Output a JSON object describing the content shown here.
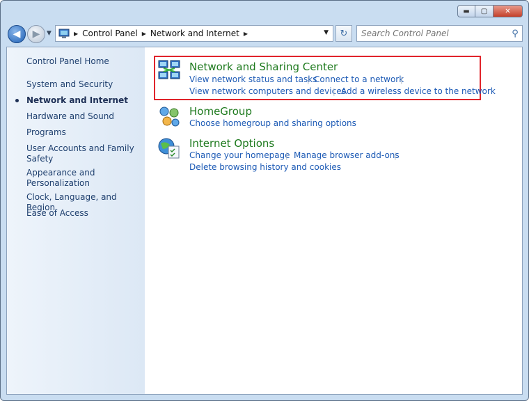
{
  "window": {
    "caption": {
      "minimize_glyph": "▬",
      "maximize_glyph": "▢",
      "close_glyph": "✕"
    }
  },
  "nav": {
    "back_glyph": "◀",
    "forward_glyph": "▶",
    "breadcrumb": [
      "Control Panel",
      "Network and Internet"
    ],
    "crumb_separator": "▶",
    "refresh_glyph": "↻",
    "search_placeholder": "Search Control Panel",
    "search_glyph": "⚲"
  },
  "sidebar": {
    "home": "Control Panel Home",
    "items": [
      "System and Security",
      "Network and Internet",
      "Hardware and Sound",
      "Programs",
      "User Accounts and Family Safety",
      "Appearance and Personalization",
      "Clock, Language, and Region",
      "Ease of Access"
    ],
    "current_index": 1
  },
  "categories": [
    {
      "title": "Network and Sharing Center",
      "icon": "network-sharing-icon",
      "links": [
        "View network status and tasks",
        "Connect to a network",
        "View network computers and devices",
        "Add a wireless device to the network"
      ]
    },
    {
      "title": "HomeGroup",
      "icon": "homegroup-icon",
      "links": [
        "Choose homegroup and sharing options"
      ]
    },
    {
      "title": "Internet Options",
      "icon": "internet-options-icon",
      "links": [
        "Change your homepage",
        "Manage browser add-ons",
        "Delete browsing history and cookies"
      ]
    }
  ],
  "colors": {
    "highlight": "#e0242b",
    "category_title": "#1e7a1e",
    "link": "#1c5ab5"
  }
}
